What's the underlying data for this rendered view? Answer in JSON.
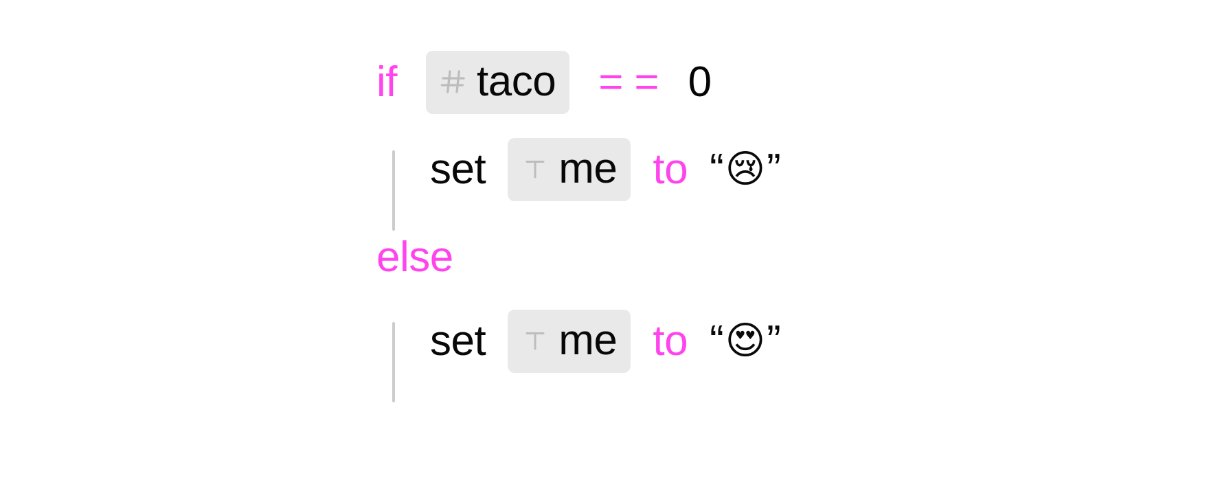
{
  "editor": {
    "background_color": "#ffffff",
    "keyword_color": "#ff44ee",
    "text_color": "#080808",
    "chip_background_color": "#e9e9e9",
    "chip_icon_color": "#bdbdbd",
    "indent_guide_color": "#cccccc"
  },
  "program": {
    "lines": [
      {
        "id": "if-condition",
        "indent": 0,
        "keyword": "if",
        "variable": {
          "name": "taco",
          "type_icon": "hash-icon",
          "type": "number"
        },
        "operator": "==",
        "operator_parts": [
          "=",
          "="
        ],
        "value": "0"
      },
      {
        "id": "set-me-sad",
        "indent": 1,
        "command": "set",
        "variable": {
          "name": "me",
          "type_icon": "text-type-icon",
          "type": "text"
        },
        "preposition": "to",
        "string": {
          "open_quote": "“",
          "emoji": "😢",
          "emoji_name": "crying-face-emoji",
          "close_quote": "”"
        }
      },
      {
        "id": "else-branch",
        "indent": 0,
        "keyword": "else"
      },
      {
        "id": "set-me-love",
        "indent": 1,
        "command": "set",
        "variable": {
          "name": "me",
          "type_icon": "text-type-icon",
          "type": "text"
        },
        "preposition": "to",
        "string": {
          "open_quote": "“",
          "emoji": "😍",
          "emoji_name": "heart-eyes-emoji",
          "close_quote": "”"
        }
      }
    ]
  }
}
